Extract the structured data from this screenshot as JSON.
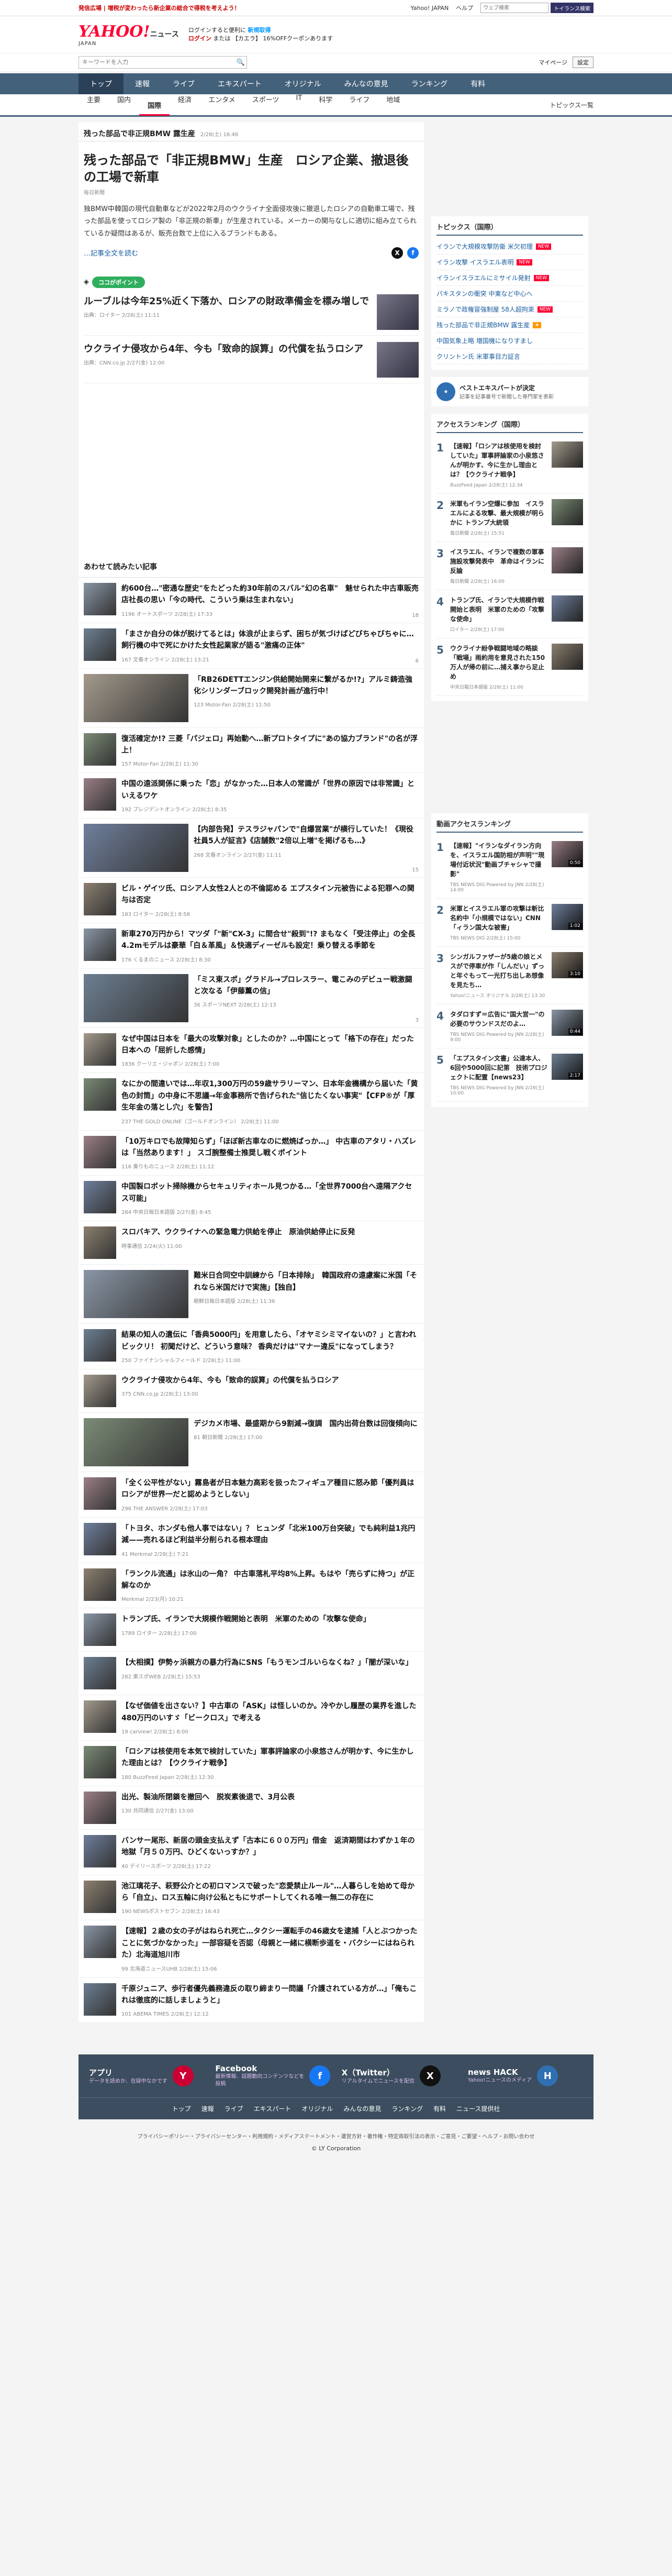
{
  "topstrip": {
    "promo": "発信広場 | 増税が変わったら新企業の総合で得税を考えよう！",
    "links": [
      "Yahoo! JAPAN",
      "ヘルプ"
    ],
    "search_placeholder": "ウェブ検索",
    "search_button": "トイランス検索"
  },
  "header": {
    "logo": "YAHOO!",
    "logo_suffix": "ニュース",
    "logo_sub": "JAPAN",
    "msg_line1": "ログインすると便利に",
    "msg_highlight": "新規取得",
    "msg_line2_login": "ログイン",
    "msg_line2": "または 【カエラ】 16%OFFクーポンあります"
  },
  "subsearch": {
    "placeholder": "キーワードを入力",
    "right_links": [
      "マイページ",
      "設定"
    ]
  },
  "mainnav": [
    {
      "label": "トップ",
      "active": true
    },
    {
      "label": "速報",
      "active": false
    },
    {
      "label": "ライブ",
      "active": false
    },
    {
      "label": "エキスパート",
      "active": false
    },
    {
      "label": "オリジナル",
      "active": false
    },
    {
      "label": "みんなの意見",
      "active": false
    },
    {
      "label": "ランキング",
      "active": false
    },
    {
      "label": "有料",
      "active": false
    }
  ],
  "subnav": {
    "items": [
      {
        "label": "主要",
        "active": false
      },
      {
        "label": "国内",
        "active": false
      },
      {
        "label": "国際",
        "active": true
      },
      {
        "label": "経済",
        "active": false
      },
      {
        "label": "エンタメ",
        "active": false
      },
      {
        "label": "スポーツ",
        "active": false
      },
      {
        "label": "IT",
        "active": false
      },
      {
        "label": "科学",
        "active": false
      },
      {
        "label": "ライフ",
        "active": false
      },
      {
        "label": "地域",
        "active": false
      }
    ],
    "topics": "トピックス一覧"
  },
  "article": {
    "crumb": "残った部品で非正規BMW 露生産",
    "crumb_date": "2/28(土) 16:46",
    "title": "残った部品で「非正規BMW」生産　ロシア企業、撤退後の工場で新車",
    "source": "毎日新聞",
    "lead": "独BMW中韓国の現代自動車などが2022年2月のウクライナ全面侵攻後に撤退したロシアの自動車工場で、残った部品を使ってロシア製の「非正規の新車」が生産されている。メーカーの関与なしに適切に組み立てられているか疑問はあるが、販売台数で上位に入るブランドもある。",
    "readmore": "…記事全文を読む"
  },
  "kokopoint": {
    "label": "ココがポイント",
    "items": [
      {
        "title": "ルーブルは今年25%近く下落か、ロシアの財政準備金を標み増しで",
        "meta": "出典：ロイター 2/28(土) 11:11"
      },
      {
        "title": "ウクライナ侵攻から4年、今も「致命的誤算」の代償を払うロシア",
        "meta": "出典：CNN.co.jp 2/27(金) 12:00"
      }
    ]
  },
  "related": {
    "title": "あわせて読みたい記事",
    "items": [
      {
        "title": "約600台…\"密通な歴史\"をたどった約30年前のスバル\"幻の名車\"　魅せられた中古車販売店社長の思い「今の時代、こういう乗は生まれない」",
        "meta": "1196 オートスポーツ 2/28(土) 17:33",
        "count": "18",
        "big": false
      },
      {
        "title": "「まさか自分の体が脱けてるとは」体浪が止まらず、困ちが気づけばどびちゃびちゃに…飼行機の中で死にかけた女性起業家が語る\"激痛の正体\"",
        "meta": "167 文春オンライン 2/28(土) 13:21",
        "count": "6",
        "big": false
      },
      {
        "title": "「RB26DETTエンジン供給開始開来に繋がるか!?」アルミ鋳造強化シリンダーブロック開発計画が進行中！",
        "meta": "123 Motor-Fan 2/28(土) 11:50",
        "count": "",
        "big": true
      },
      {
        "title": "復活確定か!? 三菱「パジェロ」再始動へ…新プロトタイプに\"あの協力ブランド\"の名が浮上！",
        "meta": "157 Motor-Fan 2/28(土) 11:30",
        "count": "",
        "big": false
      },
      {
        "title": "中国の遠派関係に乗った「恋」がなかった…日本人の常識が「世界の原因では非常識」といえるワケ",
        "meta": "192 プレジデントオンライン 2/28(土) 8:35",
        "count": "",
        "big": false
      },
      {
        "title": "【内部告発】テスラジャパンで\"自爆営業\"が横行していた！《現役社員5人が証言》《店舗数\"2倍以上増\"を掲げるも…》",
        "meta": "268 文春オンライン 2/27(金) 11:11",
        "count": "15",
        "big": true
      },
      {
        "title": "ビル・ゲイツ氏、ロシア人女性2人との不倫認める エプスタイン元被告による犯罪への関与は否定",
        "meta": "183 ロイター 2/28(土) 8:58",
        "count": "",
        "big": false
      },
      {
        "title": "新車270万円から！マツダ「\"新\"CX-3」に間合せ\"殺到\"!? まもなく「受注停止」の全長4.2mモデルは豪華「白＆革風」＆快適ディーゼルも設定！乗り替える季節を",
        "meta": "176 くるまのニュース 2/28(土) 8:30",
        "count": "",
        "big": false
      },
      {
        "title": "「ミス東スポ」グラドル→プロレスラー、電こみのデビュー戦激闘と次なる「伊藤薫の信」",
        "meta": "36 スポーツNEXT 2/28(土) 12:13",
        "count": "3",
        "big": true
      },
      {
        "title": "なぜ中国は日本を「最大の攻撃対象」としたのか？…中国にとって「格下の存在」だった日本への「屈折した感情」",
        "meta": "1836 クーリエ・ジャポン 2/28(土) 7:00",
        "count": "",
        "big": false
      },
      {
        "title": "なにかの間違いでは…年収1,300万円の59歳サラリーマン、日本年金機構から届いた「黄色の封筒」の中身に不思議→年金事務所で告げられた\"信じたくない事実\"【CFP®が「厚生年金の落とし穴」を警告】",
        "meta": "237 THE GOLD ONLINE（ゴールドオンライン） 2/28(土) 11:00",
        "count": "",
        "big": false
      },
      {
        "title": "「10万キロでも故障知らず」「ほぼ新古車なのに燃焼ばっか…」 中古車のアタリ・ハズレは「当然あります！」 スゴ腕整備士推奨し戦くポイント",
        "meta": "116 乗りものニュース 2/28(土) 11:12",
        "count": "",
        "big": false
      },
      {
        "title": "中国製ロボット掃除機からセキュリティホール見つかる…「全世界7000台へ遠隔アクセス可能」",
        "meta": "284 中央日報日本語版 2/27(金) 8:45",
        "count": "",
        "big": false
      },
      {
        "title": "スロバキア、ウクライナへの緊急電力供給を停止　原油供給停止に反発",
        "meta": "時事通信 2/24(火) 11:00",
        "count": "",
        "big": false
      },
      {
        "title": "難米日合同空中訓練から「日本排除」　韓国政府の遠慮案に米国「それなら米国だけで実施」【独自】",
        "meta": "朝鮮日報日本語版 2/28(土) 11:36",
        "count": "",
        "big": true
      },
      {
        "title": "結果の知人の遺伝に「香典5000円」を用意したら、「オヤミシミマイないの？」と言われビックリ！ 初聞だけど、どういう意味？ 香典だけは\"マナー違反\"になってしまう？",
        "meta": "250 ファイナンシャルフィールド 2/28(土) 11:00",
        "count": "",
        "big": false
      },
      {
        "title": "ウクライナ侵攻から4年、今も「致命的誤算」の代償を払うロシア",
        "meta": "375 CNN.co.jp 2/28(土) 13:00",
        "count": "",
        "big": false
      },
      {
        "title": "デジカメ市場、最盛期から9割減→復調　国内出荷台数は回復傾向に",
        "meta": "81 朝日新聞 2/28(土) 17:00",
        "count": "",
        "big": true
      },
      {
        "title": "「全く公平性がない」霧島者が日本魅力高彩を扱ったフィギュア種目に怒み節「優判員はロシアが世界一だと認めようとしない」",
        "meta": "296 THE ANSWER 2/28(土) 17:03",
        "count": "",
        "big": false
      },
      {
        "title": "「トヨタ、ホンダも他人事ではない」？ ヒュンダ「北米100万台突破」でも純利益1兆円減——売れるほど利益半分削られる根本理由",
        "meta": "41 Merkmal 2/28(土) 7:21",
        "count": "",
        "big": false
      },
      {
        "title": "「ランクル流通」は氷山の一角？ 中古車落札平均8%上昇。もはや「売らずに持つ」が正解なのか",
        "meta": "Merkmal 2/23(月) 10:21",
        "count": "",
        "big": false
      },
      {
        "title": "トランプ氏、イランで大規模作戦開始と表明　米軍のための「攻撃な使命」",
        "meta": "1789 ロイター 2/28(土) 17:00",
        "count": "",
        "big": false
      },
      {
        "title": "【大相撲】伊勢ヶ浜親方の暴力行為にSNS「もうモンゴルいらなくね？」「闇が深いな」",
        "meta": "282 東スポWEB 2/28(土) 15:53",
        "count": "",
        "big": false
      },
      {
        "title": "【なぜ価値を出さない？】中古車の「ASK」は怪しいのか。冷やかし履歴の業界を進した480万円のいすゞ「ビークロス」で考える",
        "meta": "19 carview! 2/28(土) 8:00",
        "count": "",
        "big": false
      },
      {
        "title": "「ロシアは核使用を本気で検討していた」軍事評論家の小泉悠さんが明かす、今に生かした理由とは？【ウクライナ戦争】",
        "meta": "180 BuzzFeed Japan 2/28(土) 12:30",
        "count": "",
        "big": false
      },
      {
        "title": "出光、製油所閉鎖を撤回へ　脱炭素後退で、3月公表",
        "meta": "130 共同通信 2/27(金) 13:00",
        "count": "",
        "big": false
      },
      {
        "title": "バンサー尾形、新居の頭金支払えず「古本に６００万円」借金　返済期間はわずか１年の地獄「月５０万円、ひどくないっすか？」",
        "meta": "40 デイリースポーツ 2/28(土) 17:22",
        "count": "",
        "big": false
      },
      {
        "title": "池江璃花子、萩野公介との初ロマンスで破った\"恋愛禁止ルール\"…人暮らしを始めて母から「自立」、ロス五輪に向け公私ともにサポートしてくれる唯一無二の存在に",
        "meta": "190 NEWSポストセブン 2/28(土) 16:43",
        "count": "",
        "big": false
      },
      {
        "title": "【速報】２歳の女の子がはねられ死亡…タクシー運転手の46歳女を逮捕「人とぶつかったことに気づかなかった」一部容疑を否認（母親と一緒に横断歩道を・バクシーにはねられた）北海道旭川市",
        "meta": "99 北海道ニュースUHB 2/28(土) 15:06",
        "count": "",
        "big": false
      },
      {
        "title": "千原ジュニア、歩行者優先義務違反の取り締まり一問議「介護されている方が…」「俺もこれは徹底的に話しましょうと」",
        "meta": "101 ABEMA TIMES 2/28(土) 12:12",
        "count": "",
        "big": false
      }
    ]
  },
  "sidebar": {
    "topics_title": "トピックス（国際）",
    "topics": [
      {
        "label": "イランで大規模攻撃防衛 米欠初理",
        "tag": "new"
      },
      {
        "label": "イラン攻撃 イスラエル表明",
        "tag": "new"
      },
      {
        "label": "イランイスラエルにミサイル発射",
        "tag": "new"
      },
      {
        "label": "パキスタンの衝突 中東など中心へ",
        "tag": ""
      },
      {
        "label": "ミラノで政権冒強制屋 58人超拘束",
        "tag": "new"
      },
      {
        "label": "残った部品で非正規BMW 露生産",
        "tag": "hot"
      },
      {
        "label": "中国気象上略 増国機になりすまし",
        "tag": ""
      },
      {
        "label": "クリントン氏 米軍事目力証言",
        "tag": ""
      }
    ],
    "expert_title": "ベストエキスパートが決定",
    "expert_sub": "記事を記事番号で新聞した専門家を表彰",
    "ranking_title": "アクセスランキング（国際）",
    "ranking": [
      {
        "num": "1",
        "title": "【速報】「ロシアは核使用を検討していた」軍事評論家の小泉悠さんが明かす、今に生かし理由とは？【ウクライナ戦争】",
        "meta": "BuzzFeed Japan 2/28(土) 12:34"
      },
      {
        "num": "2",
        "title": "米軍もイラン空爆に参加　イスラエルによる攻撃、最大規模が明らかに トランプ大統領",
        "meta": "毎日新聞 2/28(土) 15:51"
      },
      {
        "num": "3",
        "title": "イスラエル、イランで複数の軍事施設攻撃発表中　革命はイランに反論",
        "meta": "毎日新聞 2/28(土) 16:00"
      },
      {
        "num": "4",
        "title": "トランプ氏、イランで大規模作戦開始と表明　米軍のための「攻撃な使命」",
        "meta": "ロイター 2/28(土) 17:00"
      },
      {
        "num": "5",
        "title": "ウクライナ紛争戦闘地域の略談「戦場」雨約用を意見された150万人が帰の前に…捕え事から足止め",
        "meta": "中央日報日本語版 2/28(土) 11:00"
      }
    ],
    "video_title": "動画アクセスランキング",
    "videos": [
      {
        "num": "1",
        "title": "【速報】\"イランなダイラン方向を、イスラエル国防相が声明\"\"現場付近状況\"動画ブチャシャで撮影\"",
        "meta": "TBS NEWS DIG Powered by JNN 2/28(土) 14:00",
        "dur": "0:50"
      },
      {
        "num": "2",
        "title": "米軍とイスラエル軍の攻撃は斬比名約中「小規模ではない」CNN「ィラン国大な被害」",
        "meta": "TBS NEWS DIG 2/28(土) 15:00",
        "dur": "1:02"
      },
      {
        "num": "3",
        "title": "シンガルファザーが5歳の娘とメスがで停車が作「しんだい」ずっと年ぐもって一光打ち出しあ想像を見たち…",
        "meta": "Yahoo!ニュース オリジナル 2/28(土) 13:30",
        "dur": "3:10"
      },
      {
        "num": "4",
        "title": "タダロすず＝広告に\"国大営一\"の必要のサウンドスだのよ…",
        "meta": "TBS NEWS DIG Powered by JNN 2/28(土) 9:00",
        "dur": "0:44"
      },
      {
        "num": "5",
        "title": "「エプスタイン文書」公達本人、6回や5000回に記第　技術プロジェクトに配置【news23】",
        "meta": "TBS NEWS DIG Powered by JNN 2/28(土) 10:00",
        "dur": "2:17"
      }
    ]
  },
  "footer": {
    "apps": [
      {
        "title": "アプリ",
        "desc": "データを読めか、在録中なかです",
        "icon": "Y"
      },
      {
        "title": "Facebook",
        "desc": "最新情報、話題動向コンテンツなどを投稿",
        "icon": "f"
      },
      {
        "title": "X（Twitter）",
        "desc": "リアルタイムでニュースを配信",
        "icon": "X"
      },
      {
        "title": "news HACK",
        "desc": "Yahoo!ニュースのメディア",
        "icon": "H"
      }
    ],
    "nav": [
      "トップ",
      "速報",
      "ライブ",
      "エキスパート",
      "オリジナル",
      "みんなの意見",
      "ランキング",
      "有料",
      "ニュース提供社"
    ],
    "links": "プライバシーポリシー・プライバシーセンター・利用規約・メディアステートメント・運営方針・著作権・特定商取引法の表示・ご意見・ご要望・ヘルプ・お問い合わせ",
    "copyright": "© LY Corporation"
  }
}
